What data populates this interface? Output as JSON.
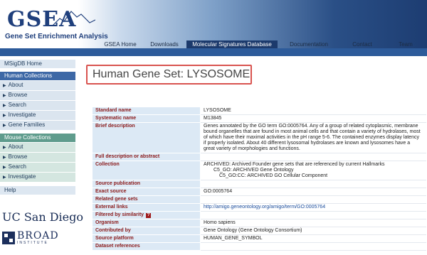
{
  "logo": {
    "word": "GSEA",
    "subtitle": "Gene Set Enrichment Analysis"
  },
  "topnav": [
    {
      "label": "GSEA Home",
      "active": false
    },
    {
      "label": "Downloads",
      "active": false
    },
    {
      "label": "Molecular Signatures Database",
      "active": true
    },
    {
      "label": "Documentation",
      "active": false
    },
    {
      "label": "Contact",
      "active": false
    },
    {
      "label": "Team",
      "active": false
    }
  ],
  "sidebar": {
    "home": "MSigDB Home",
    "human_header": "Human Collections",
    "human_items": [
      "About",
      "Browse",
      "Search",
      "Investigate",
      "Gene Families"
    ],
    "mouse_header": "Mouse Collections",
    "mouse_items": [
      "About",
      "Browse",
      "Search",
      "Investigate"
    ],
    "help": "Help"
  },
  "logos": {
    "ucsd": "UC San Diego",
    "broad": "BROAD",
    "broad_sub": "INSTITUTE"
  },
  "page_title": "Human Gene Set: LYSOSOME",
  "geneset": {
    "standard_name_label": "Standard name",
    "standard_name": "LYSOSOME",
    "systematic_name_label": "Systematic name",
    "systematic_name": "M13845",
    "brief_description_label": "Brief description",
    "brief_description": "Genes annotated by the GO term GO:0005764. Any of a group of related cytoplasmic, membrane bound organelles that are found in most animal cells and that contain a variety of hydrolases, most of which have their maximal activities in the pH range 5-6. The contained enzymes display latency if properly isolated. About 40 different lysosomal hydrolases are known and lysosomes have a great variety of morphologies and functions.",
    "full_description_label": "Full description or abstract",
    "full_description": "",
    "collection_label": "Collection",
    "collection_line1": "ARCHIVED: Archived Founder gene sets that are referenced by current Hallmarks",
    "collection_line2": "C5_GO: ARCHIVED Gene Ontology",
    "collection_line3": "C5_GO:CC: ARCHIVED GO Cellular Component",
    "source_publication_label": "Source publication",
    "source_publication": "",
    "exact_source_label": "Exact source",
    "exact_source": "GO:0005764",
    "related_gene_sets_label": "Related gene sets",
    "related_gene_sets": "",
    "external_links_label": "External links",
    "external_links": "http://amigo.geneontology.org/amigo/term/GO:0005764",
    "filtered_by_similarity_label": "Filtered by similarity",
    "filtered_by_similarity_help": "?",
    "organism_label": "Organism",
    "organism": "Homo sapiens",
    "contributed_by_label": "Contributed by",
    "contributed_by": "Gene Ontology (Gene Ontology Consortium)",
    "source_platform_label": "Source platform",
    "source_platform": "HUMAN_GENE_SYMBOL",
    "dataset_references_label": "Dataset references",
    "dataset_references": ""
  }
}
